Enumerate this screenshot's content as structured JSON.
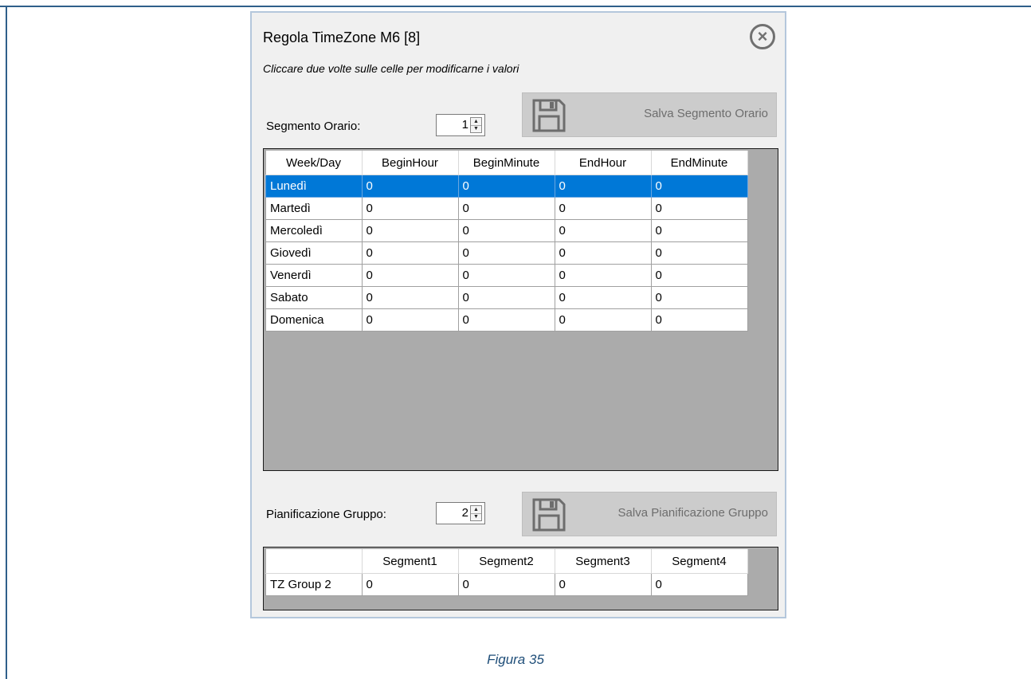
{
  "dialog": {
    "title": "Regola TimeZone M6 [8]",
    "close_icon": "close-circle-icon",
    "hint": "Cliccare due volte sulle celle per modificarne i valori"
  },
  "segment": {
    "label": "Segmento Orario:",
    "value": "1",
    "save_label": "Salva Segmento Orario",
    "save_icon": "floppy-disk-icon"
  },
  "week_grid": {
    "headers": [
      "Week/Day",
      "BeginHour",
      "BeginMinute",
      "EndHour",
      "EndMinute"
    ],
    "rows": [
      {
        "day": "Lunedì",
        "values": [
          "0",
          "0",
          "0",
          "0"
        ],
        "selected": true
      },
      {
        "day": "Martedì",
        "values": [
          "0",
          "0",
          "0",
          "0"
        ]
      },
      {
        "day": "Mercoledì",
        "values": [
          "0",
          "0",
          "0",
          "0"
        ]
      },
      {
        "day": "Giovedì",
        "values": [
          "0",
          "0",
          "0",
          "0"
        ]
      },
      {
        "day": "Venerdì",
        "values": [
          "0",
          "0",
          "0",
          "0"
        ]
      },
      {
        "day": "Sabato",
        "values": [
          "0",
          "0",
          "0",
          "0"
        ]
      },
      {
        "day": "Domenica",
        "values": [
          "0",
          "0",
          "0",
          "0"
        ]
      }
    ]
  },
  "group": {
    "label": "Pianificazione Gruppo:",
    "value": "2",
    "save_label": "Salva Pianificazione Gruppo",
    "save_icon": "floppy-disk-icon"
  },
  "group_grid": {
    "headers": [
      "",
      "Segment1",
      "Segment2",
      "Segment3",
      "Segment4"
    ],
    "rows": [
      {
        "name": "TZ Group 2",
        "values": [
          "0",
          "0",
          "0",
          "0"
        ]
      }
    ]
  },
  "caption": "Figura 35",
  "colors": {
    "selection": "#0078d7",
    "grid_background": "#ababab",
    "frame": "#2f5f8a",
    "caption": "#1f4e79"
  }
}
